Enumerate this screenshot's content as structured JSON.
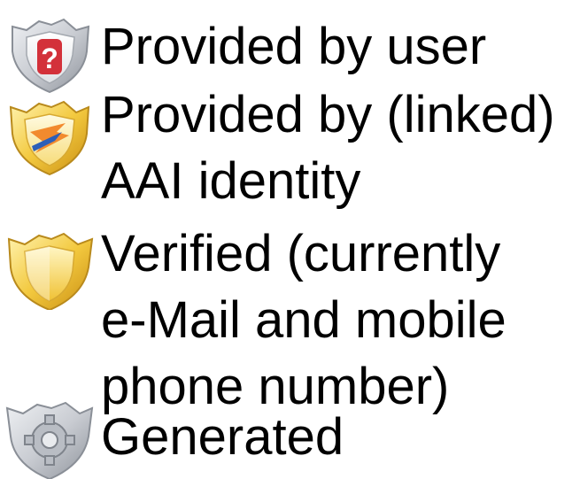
{
  "legend": {
    "items": [
      {
        "icon": "shield-question-icon",
        "lines": [
          "Provided by user"
        ]
      },
      {
        "icon": "shield-aai-icon",
        "lines": [
          "Provided by (linked)",
          "AAI identity"
        ]
      },
      {
        "icon": "shield-verified-icon",
        "lines": [
          "Verified (currently",
          "e-Mail and mobile",
          "phone number)"
        ]
      },
      {
        "icon": "shield-gear-icon",
        "lines": [
          "Generated"
        ]
      }
    ]
  },
  "colors": {
    "text": "#000000",
    "background": "#ffffff",
    "silver_shield": "#c9ccd2",
    "gold_shield": "#f3c93f",
    "question_red": "#d3313a",
    "aai_blue": "#2d5fb8",
    "aai_orange": "#f28a2e"
  }
}
